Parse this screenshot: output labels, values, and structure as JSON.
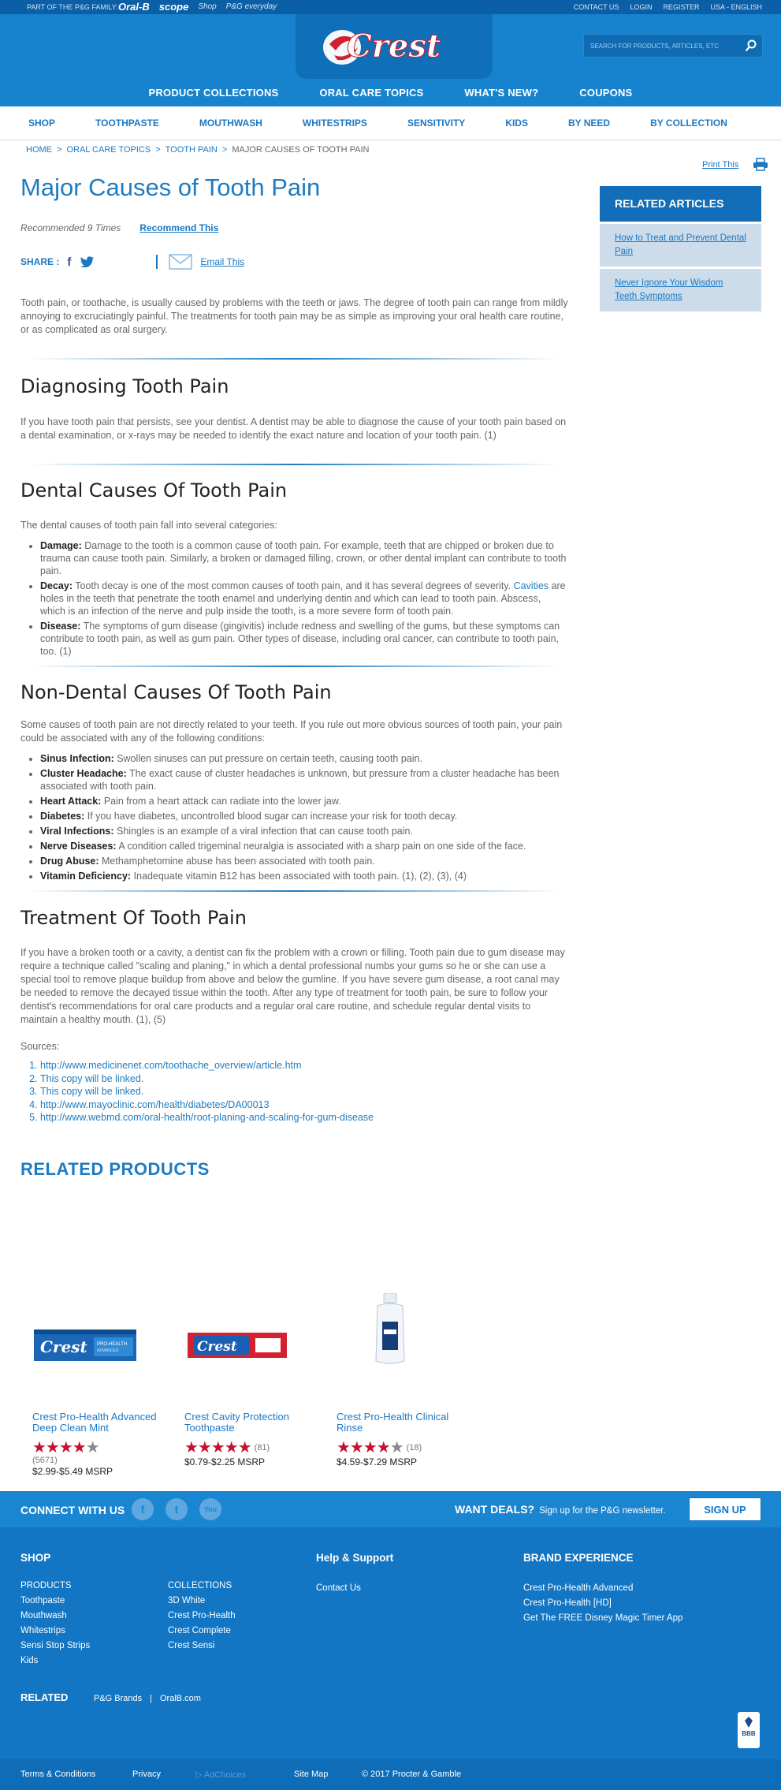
{
  "topbar": {
    "family_label": "PART OF THE P&G FAMILY:",
    "brands": [
      "Oral-B",
      "scope",
      "Shop",
      "P&G everyday"
    ],
    "links": [
      "CONTACT US",
      "LOGIN",
      "REGISTER",
      "USA - ENGLISH"
    ]
  },
  "header": {
    "logo_text": "Crest",
    "search_placeholder": "SEARCH FOR PRODUCTS, ARTICLES, ETC",
    "main_nav": [
      "PRODUCT COLLECTIONS",
      "ORAL CARE TOPICS",
      "WHAT'S NEW?",
      "COUPONS"
    ]
  },
  "subnav": [
    "SHOP",
    "TOOTHPASTE",
    "MOUTHWASH",
    "WHITESTRIPS",
    "SENSITIVITY",
    "KIDS",
    "BY NEED",
    "BY COLLECTION"
  ],
  "breadcrumb": {
    "items": [
      "HOME",
      "ORAL CARE TOPICS",
      "TOOTH PAIN",
      "MAJOR CAUSES OF TOOTH PAIN"
    ],
    "sep": ">"
  },
  "print_label": "Print This",
  "article": {
    "title": "Major Causes of Tooth Pain",
    "recommended": "Recommended 9 Times",
    "recommend_btn": "Recommend This",
    "share_label": "SHARE :",
    "email_label": "Email This",
    "intro": "Tooth pain, or toothache, is usually caused by problems with the teeth or jaws. The degree of tooth pain can range from mildly annoying to excruciatingly painful. The treatments for tooth pain may be as simple as improving your oral health care routine, or as complicated as oral surgery.",
    "diagnosing": {
      "heading": "Diagnosing Tooth Pain",
      "text": "If you have tooth pain that persists, see your dentist. A dentist may be able to diagnose the cause of your tooth pain based on a dental examination, or x-rays may be needed to identify the exact nature and location of your tooth pain. (1)"
    },
    "dental": {
      "heading": "Dental Causes Of Tooth Pain",
      "lead": "The dental causes of tooth pain fall into several categories:",
      "damage_label": "Damage:",
      "damage_text": " Damage to the tooth is a common cause of tooth pain. For example, teeth that are chipped or broken due to trauma can cause tooth pain. Similarly, a broken or damaged filling, crown, or other dental implant can contribute to tooth pain.",
      "decay_label": "Decay:",
      "decay_text1": " Tooth decay is one of the most common causes of tooth pain, and it has several degrees of severity. ",
      "decay_link": "Cavities",
      "decay_text2": " are holes in the teeth that penetrate the tooth enamel and underlying dentin and which can lead to tooth pain. Abscess, which is an infection of the nerve and pulp inside the tooth, is a more severe form of tooth pain.",
      "disease_label": "Disease:",
      "disease_text": " The symptoms of gum disease (gingivitis) include redness and swelling of the gums, but these symptoms can contribute to tooth pain, as well as gum pain. Other types of disease, including oral cancer, can contribute to tooth pain, too. (1)"
    },
    "nondental": {
      "heading": "Non-Dental Causes Of Tooth Pain",
      "lead": "Some causes of tooth pain are not directly related to your teeth. If you rule out more obvious sources of tooth pain, your pain could be associated with any of the following conditions:",
      "items": [
        {
          "label": "Sinus Infection:",
          "text": " Swollen sinuses can put pressure on certain teeth, causing tooth pain."
        },
        {
          "label": "Cluster Headache:",
          "text": " The exact cause of cluster headaches is unknown, but pressure from a cluster headache has been associated with tooth pain."
        },
        {
          "label": "Heart Attack:",
          "text": " Pain from a heart attack can radiate into the lower jaw."
        },
        {
          "label": "Diabetes:",
          "text": " If you have diabetes, uncontrolled blood sugar can increase your risk for tooth decay."
        },
        {
          "label": "Viral Infections:",
          "text": " Shingles is an example of a viral infection that can cause tooth pain."
        },
        {
          "label": "Nerve Diseases:",
          "text": " A condition called trigeminal neuralgia is associated with a sharp pain on one side of the face."
        },
        {
          "label": "Drug Abuse:",
          "text": " Methamphetomine abuse has been associated with tooth pain."
        },
        {
          "label": "Vitamin Deficiency:",
          "text": " Inadequate vitamin B12 has been associated with tooth pain. (1), (2), (3), (4)"
        }
      ]
    },
    "treatment": {
      "heading": "Treatment Of Tooth Pain",
      "text": "If you have a broken tooth or a cavity, a dentist can fix the problem with a crown or filling. Tooth pain due to gum disease may require a technique called \"scaling and planing,\" in which a dental professional numbs your gums so he or she can use a special tool to remove plaque buildup from above and below the gumline. If you have severe gum disease, a root canal may be needed to remove the decayed tissue within the tooth. After any type of treatment for tooth pain, be sure to follow your dentist's recommendations for oral care products and a regular oral care routine, and schedule regular dental visits to maintain a healthy mouth. (1), (5)"
    },
    "sources_label": "Sources:",
    "sources": [
      "http://www.medicinenet.com/toothache_overview/article.htm",
      "This copy will be linked.",
      "This copy will be linked.",
      "http://www.mayoclinic.com/health/diabetes/DA00013",
      "http://www.webmd.com/oral-health/root-planing-and-scaling-for-gum-disease"
    ]
  },
  "sidebar": {
    "heading": "RELATED ARTICLES",
    "items": [
      "How to Treat and Prevent Dental Pain",
      "Never Ignore Your Wisdom Teeth Symptoms"
    ]
  },
  "related_products": {
    "heading": "RELATED PRODUCTS",
    "products": [
      {
        "name": "Crest Pro-Health Advanced Deep Clean Mint",
        "rating": 4,
        "count": "(5671)",
        "price": "$2.99-$5.49 MSRP",
        "image": "pro-health-toothpaste-box"
      },
      {
        "name": "Crest Cavity Protection Toothpaste",
        "rating": 5,
        "count": "(81)",
        "price": "$0.79-$2.25 MSRP",
        "image": "cavity-protection-toothpaste-box"
      },
      {
        "name": "Crest Pro-Health Clinical Rinse",
        "rating": 4,
        "count": "(18)",
        "price": "$4.59-$7.29 MSRP",
        "image": "rinse-bottle"
      }
    ]
  },
  "footer": {
    "connect": "CONNECT WITH US",
    "social": [
      "f",
      "t",
      "You"
    ],
    "deals": "WANT DEALS?",
    "deals_text": "Sign up for the P&G newsletter.",
    "signup": "SIGN UP",
    "shop_heading": "SHOP",
    "products_col": [
      "PRODUCTS",
      "Toothpaste",
      "Mouthwash",
      "Whitestrips",
      "Sensi Stop Strips",
      "Kids"
    ],
    "collections_col": [
      "COLLECTIONS",
      "3D White",
      "Crest Pro-Health",
      "Crest Complete",
      "Crest Sensi"
    ],
    "help_heading": "Help & Support",
    "help_links": [
      "Contact Us"
    ],
    "brand_heading": "BRAND EXPERIENCE",
    "brand_links": [
      "Crest Pro-Health Advanced",
      "Crest Pro-Health [HD]",
      "Get The FREE Disney Magic Timer App"
    ],
    "related_heading": "RELATED",
    "related_links": [
      "P&G Brands",
      "|",
      "OralB.com"
    ],
    "bbb": "BBB",
    "bottom_links": [
      "Terms & Conditions",
      "Privacy",
      "AdChoices",
      "Site Map",
      "© 2017 Procter & Gamble"
    ]
  },
  "colors": {
    "brand_blue": "#1783cf",
    "link_blue": "#1f7cc1",
    "star_red": "#c8102e"
  }
}
